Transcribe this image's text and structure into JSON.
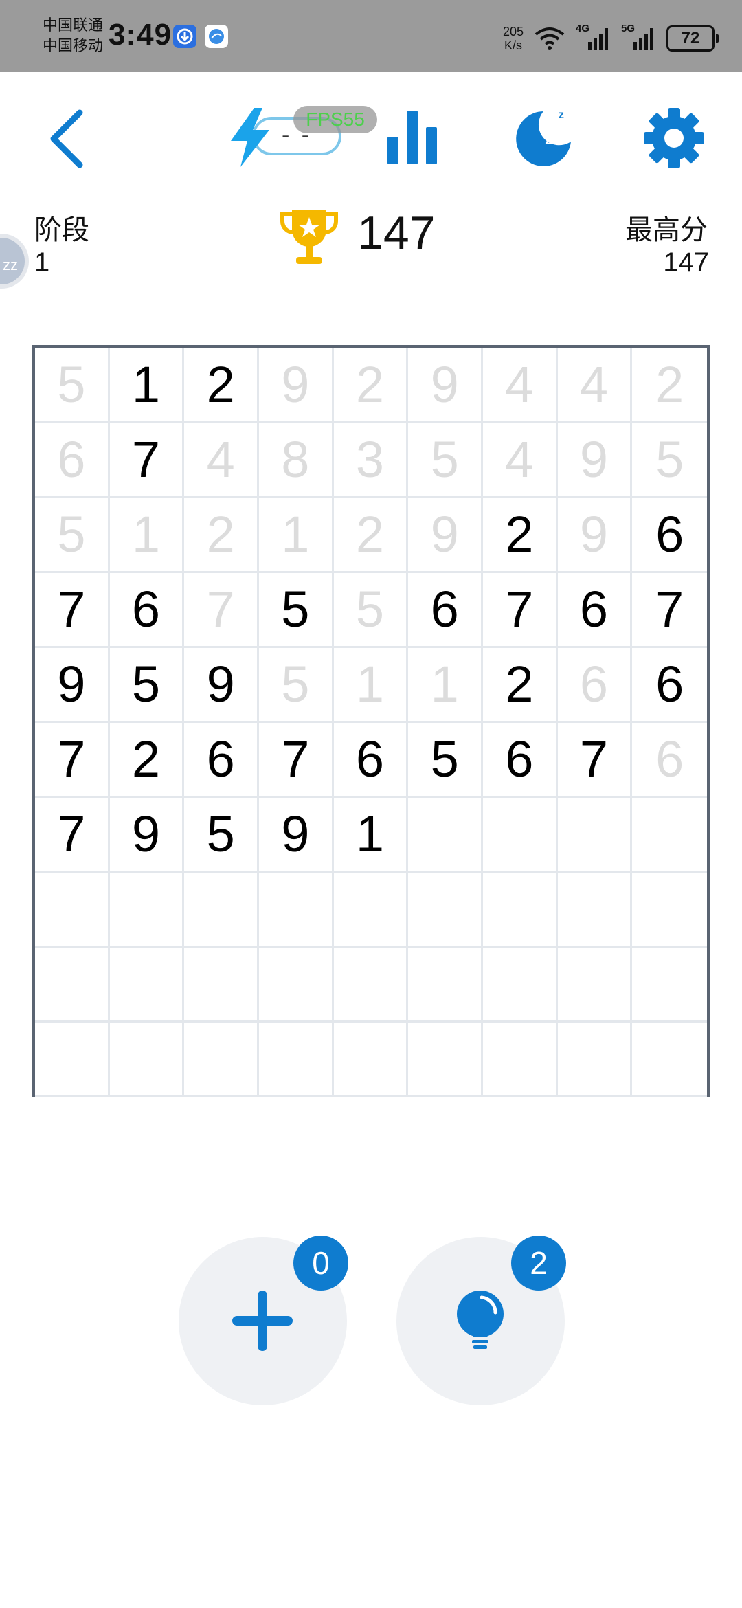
{
  "status_bar": {
    "carrier_1": "中国联通",
    "carrier_2": "中国移动",
    "time": "3:49",
    "net_speed_value": "205",
    "net_speed_unit": "K/s",
    "signal_1": "4G",
    "signal_2": "5G",
    "battery": "72"
  },
  "toolbar": {
    "energy_value": "- -",
    "fps": "FPS55"
  },
  "stats": {
    "stage_label": "阶段",
    "stage_value": "1",
    "score": "147",
    "best_label": "最高分",
    "best_value": "147",
    "zz": "zz"
  },
  "board": {
    "columns": 9,
    "rows": [
      [
        {
          "v": "5",
          "done": true
        },
        {
          "v": "1",
          "done": false
        },
        {
          "v": "2",
          "done": false
        },
        {
          "v": "9",
          "done": true
        },
        {
          "v": "2",
          "done": true
        },
        {
          "v": "9",
          "done": true
        },
        {
          "v": "4",
          "done": true
        },
        {
          "v": "4",
          "done": true
        },
        {
          "v": "2",
          "done": true
        }
      ],
      [
        {
          "v": "6",
          "done": true
        },
        {
          "v": "7",
          "done": false
        },
        {
          "v": "4",
          "done": true
        },
        {
          "v": "8",
          "done": true
        },
        {
          "v": "3",
          "done": true
        },
        {
          "v": "5",
          "done": true
        },
        {
          "v": "4",
          "done": true
        },
        {
          "v": "9",
          "done": true
        },
        {
          "v": "5",
          "done": true
        }
      ],
      [
        {
          "v": "5",
          "done": true
        },
        {
          "v": "1",
          "done": true
        },
        {
          "v": "2",
          "done": true
        },
        {
          "v": "1",
          "done": true
        },
        {
          "v": "2",
          "done": true
        },
        {
          "v": "9",
          "done": true
        },
        {
          "v": "2",
          "done": false
        },
        {
          "v": "9",
          "done": true
        },
        {
          "v": "6",
          "done": false
        }
      ],
      [
        {
          "v": "7",
          "done": false
        },
        {
          "v": "6",
          "done": false
        },
        {
          "v": "7",
          "done": true
        },
        {
          "v": "5",
          "done": false
        },
        {
          "v": "5",
          "done": true
        },
        {
          "v": "6",
          "done": false
        },
        {
          "v": "7",
          "done": false
        },
        {
          "v": "6",
          "done": false
        },
        {
          "v": "7",
          "done": false
        }
      ],
      [
        {
          "v": "9",
          "done": false
        },
        {
          "v": "5",
          "done": false
        },
        {
          "v": "9",
          "done": false
        },
        {
          "v": "5",
          "done": true
        },
        {
          "v": "1",
          "done": true
        },
        {
          "v": "1",
          "done": true
        },
        {
          "v": "2",
          "done": false
        },
        {
          "v": "6",
          "done": true
        },
        {
          "v": "6",
          "done": false
        }
      ],
      [
        {
          "v": "7",
          "done": false
        },
        {
          "v": "2",
          "done": false
        },
        {
          "v": "6",
          "done": false
        },
        {
          "v": "7",
          "done": false
        },
        {
          "v": "6",
          "done": false
        },
        {
          "v": "5",
          "done": false
        },
        {
          "v": "6",
          "done": false
        },
        {
          "v": "7",
          "done": false
        },
        {
          "v": "6",
          "done": true
        }
      ],
      [
        {
          "v": "7",
          "done": false
        },
        {
          "v": "9",
          "done": false
        },
        {
          "v": "5",
          "done": false
        },
        {
          "v": "9",
          "done": false
        },
        {
          "v": "1",
          "done": false
        },
        {
          "v": "",
          "done": false
        },
        {
          "v": "",
          "done": false
        },
        {
          "v": "",
          "done": false
        },
        {
          "v": "",
          "done": false
        }
      ],
      [
        {
          "v": "",
          "done": false
        },
        {
          "v": "",
          "done": false
        },
        {
          "v": "",
          "done": false
        },
        {
          "v": "",
          "done": false
        },
        {
          "v": "",
          "done": false
        },
        {
          "v": "",
          "done": false
        },
        {
          "v": "",
          "done": false
        },
        {
          "v": "",
          "done": false
        },
        {
          "v": "",
          "done": false
        }
      ],
      [
        {
          "v": "",
          "done": false
        },
        {
          "v": "",
          "done": false
        },
        {
          "v": "",
          "done": false
        },
        {
          "v": "",
          "done": false
        },
        {
          "v": "",
          "done": false
        },
        {
          "v": "",
          "done": false
        },
        {
          "v": "",
          "done": false
        },
        {
          "v": "",
          "done": false
        },
        {
          "v": "",
          "done": false
        }
      ],
      [
        {
          "v": "",
          "done": false
        },
        {
          "v": "",
          "done": false
        },
        {
          "v": "",
          "done": false
        },
        {
          "v": "",
          "done": false
        },
        {
          "v": "",
          "done": false
        },
        {
          "v": "",
          "done": false
        },
        {
          "v": "",
          "done": false
        },
        {
          "v": "",
          "done": false
        },
        {
          "v": "",
          "done": false
        }
      ]
    ]
  },
  "actions": {
    "add_count": "0",
    "hint_count": "2"
  },
  "colors": {
    "accent": "#0f7ccf",
    "faded_digit": "#dcdcdc",
    "trophy": "#f5b800"
  }
}
